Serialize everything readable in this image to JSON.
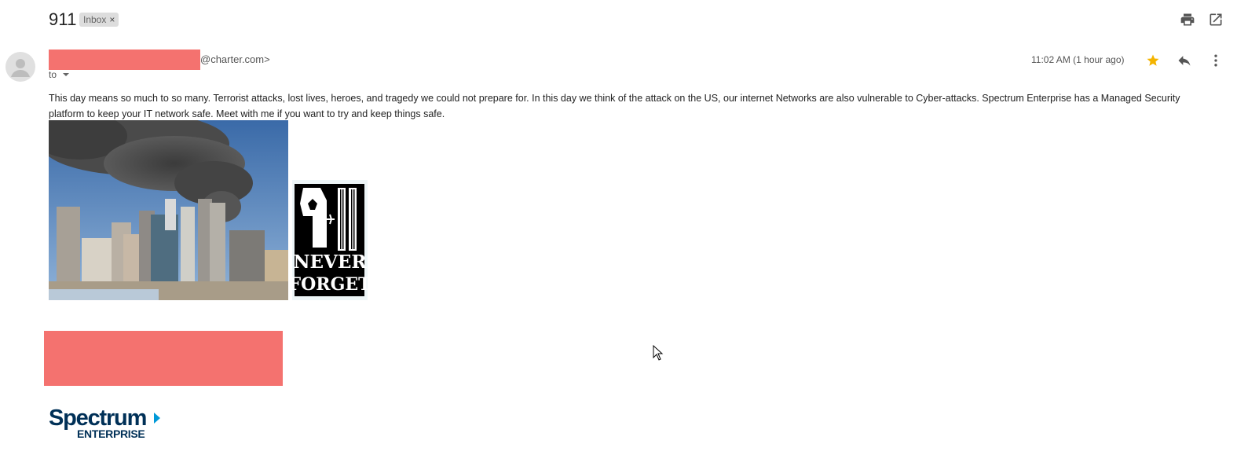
{
  "email": {
    "subject": "911",
    "label_chip": "Inbox",
    "label_remove": "×",
    "sender_email_suffix": "@charter.com>",
    "recipient_prefix": "to",
    "timestamp": "11:02 AM (1 hour ago)",
    "body": "This day means so much to so many.  Terrorist attacks, lost lives, heroes, and tragedy we could not prepare for.  In this day we think of the attack on the US, our internet Networks are also vulnerable to Cyber-attacks.  Spectrum Enterprise has a Managed Security platform to keep your IT network safe.  Meet with me if you want to try and keep things safe.",
    "memorial_image_text": {
      "line1": "NEVER",
      "line2": "FORGET"
    },
    "signature_logo": {
      "brand": "Spectrum",
      "sub": "ENTERPRISE"
    }
  },
  "icons": {
    "print": "print-icon",
    "open_new_window": "open-in-new-window-icon",
    "star": "star-icon",
    "reply": "reply-icon",
    "more": "more-vertical-icon",
    "avatar": "default-avatar-icon",
    "cursor": "mouse-cursor-icon"
  },
  "colors": {
    "star": "#f4b400",
    "redaction": "#f4726f",
    "spectrum_blue": "#003057",
    "spectrum_arrow": "#0099d8",
    "chip_bg": "#dddddd"
  }
}
